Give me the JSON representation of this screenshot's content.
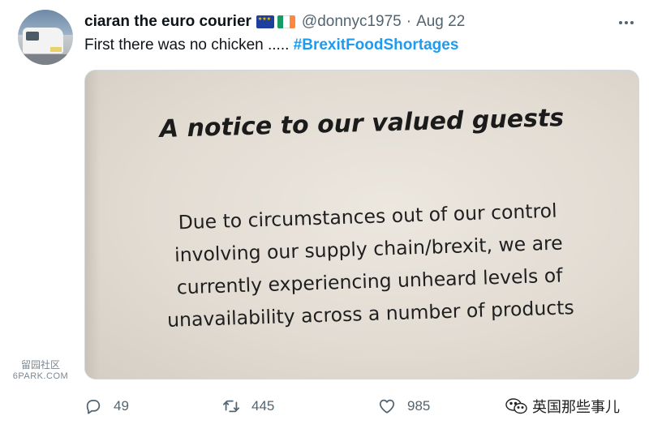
{
  "tweet": {
    "author_name": "ciaran the euro courier",
    "handle": "@donnyc1975",
    "separator": "·",
    "date": "Aug 22",
    "text": "First there was no chicken ..... ",
    "hashtag": "#BrexitFoodShortages"
  },
  "icons": {
    "avatar": "van-photo-avatar",
    "flags": [
      "eu-flag-icon",
      "ireland-flag-icon"
    ],
    "more": "more-horizontal-icon",
    "reply": "reply-icon",
    "retweet": "retweet-icon",
    "like": "heart-icon",
    "share": "wechat-icon"
  },
  "photo": {
    "notice_title": "A notice to our valued guests",
    "notice_lines": [
      "Due to circumstances out of our control",
      "involving our supply chain/brexit, we are",
      "currently experiencing unheard levels of",
      "unavailability across a number of products"
    ]
  },
  "counts": {
    "replies": "49",
    "retweets": "445",
    "likes": "985"
  },
  "watermarks": {
    "left_top": "留园社区",
    "left_bottom": "6PARK.COM",
    "right": "英国那些事儿"
  },
  "colors": {
    "link": "#1d9bf0",
    "secondary_text": "#536471",
    "eu_blue": "#1d3f9e",
    "eu_star": "#ffcc00",
    "ireland": [
      "#169b62",
      "#ffffff",
      "#ff883e"
    ]
  }
}
